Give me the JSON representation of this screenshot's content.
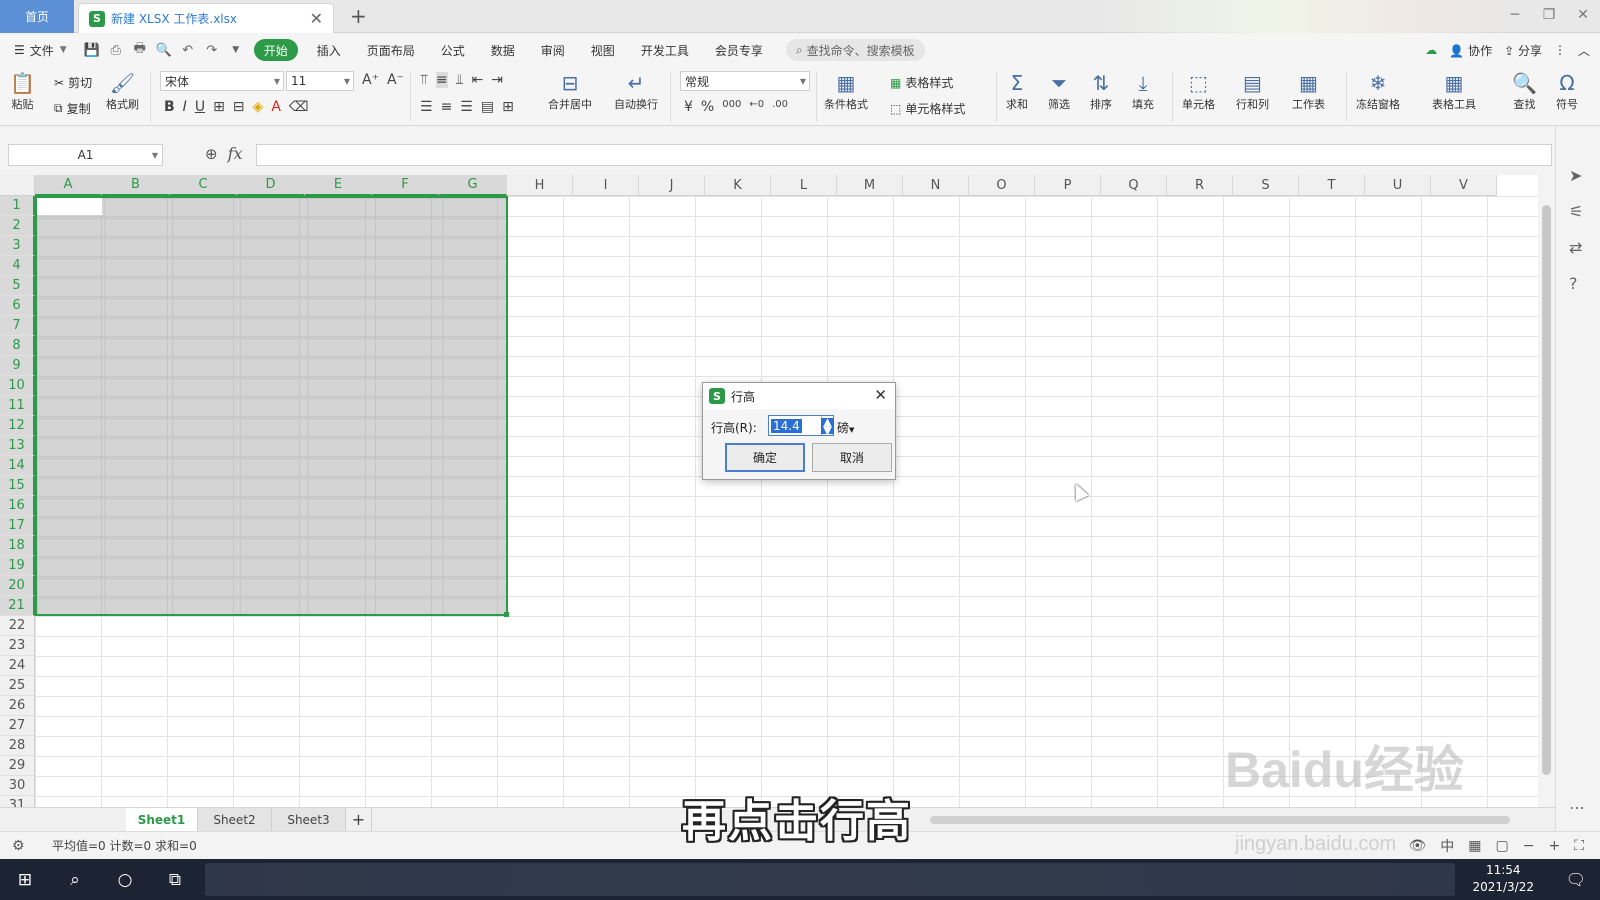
{
  "title_tabs": {
    "home": "首页",
    "file_tab": "新建 XLSX 工作表.xlsx"
  },
  "menu": {
    "file": "文件",
    "items": [
      "开始",
      "插入",
      "页面布局",
      "公式",
      "数据",
      "审阅",
      "视图",
      "开发工具",
      "会员专享"
    ],
    "search_placeholder": "查找命令、搜索模板",
    "collab": "协作",
    "share": "分享"
  },
  "ribbon": {
    "paste": "粘贴",
    "cut": "剪切",
    "copy": "复制",
    "format_painter": "格式刷",
    "font_name": "宋体",
    "font_size": "11",
    "merge_center": "合并居中",
    "wrap_text": "自动换行",
    "number_format": "常规",
    "conditional_format": "条件格式",
    "table_style": "表格样式",
    "cell_style": "单元格样式",
    "sum": "求和",
    "filter": "筛选",
    "sort": "排序",
    "fill": "填充",
    "cells": "单元格",
    "rows_cols": "行和列",
    "worksheet": "工作表",
    "freeze": "冻结窗格",
    "table_tools": "表格工具",
    "find": "查找",
    "symbol": "符号"
  },
  "formula_bar": {
    "name_box": "A1",
    "fx": "fx"
  },
  "grid": {
    "columns": [
      "A",
      "B",
      "C",
      "D",
      "E",
      "F",
      "G",
      "H",
      "I",
      "J",
      "K",
      "L",
      "M",
      "N",
      "O",
      "P",
      "Q",
      "R",
      "S",
      "T",
      "U",
      "V"
    ],
    "rows": [
      "1",
      "2",
      "3",
      "4",
      "5",
      "6",
      "7",
      "8",
      "9",
      "10",
      "11",
      "12",
      "13",
      "14",
      "15",
      "16",
      "17",
      "18",
      "19",
      "20",
      "21",
      "22",
      "23",
      "24",
      "25",
      "26",
      "27",
      "28",
      "29",
      "30",
      "31"
    ],
    "selected_range": "A1:G21"
  },
  "sheets": {
    "tabs": [
      "Sheet1",
      "Sheet2",
      "Sheet3"
    ],
    "active": "Sheet1"
  },
  "status": {
    "summary": "平均值=0  计数=0  求和=0"
  },
  "dialog": {
    "title": "行高",
    "label": "行高(R):",
    "value": "14.4",
    "unit": "磅",
    "ok": "确定",
    "cancel": "取消"
  },
  "taskbar": {
    "time": "11:54",
    "date": "2021/3/22"
  },
  "overlay": {
    "subtitle": "再点击行高",
    "watermark": "Baidu经验",
    "watermark_url": "jingyan.baidu.com"
  },
  "colors": {
    "accent_green": "#2c9a47",
    "home_tab_blue": "#5b8fd6",
    "selection_fill": "#a0a0a0"
  }
}
